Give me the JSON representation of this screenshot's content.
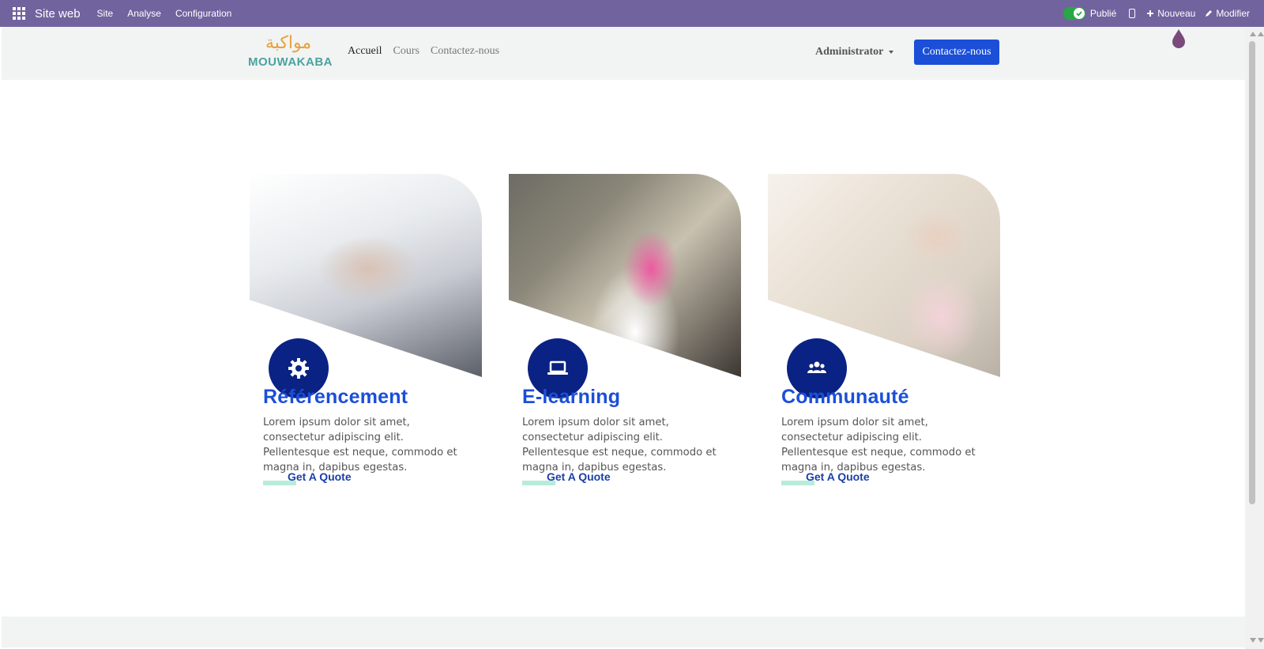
{
  "admin_bar": {
    "brand": "Site web",
    "menu": [
      "Site",
      "Analyse",
      "Configuration"
    ],
    "published_label": "Publié",
    "new_label": "Nouveau",
    "edit_label": "Modifier",
    "color": "#71639e"
  },
  "site_header": {
    "logo_arabic": "مواكبة",
    "logo_text": "MOUWAKABA",
    "nav": [
      "Accueil",
      "Cours",
      "Contactez-nous"
    ],
    "user": "Administrator",
    "cta": "Contactez-nous"
  },
  "cards": [
    {
      "icon": "gear-icon",
      "title": "Référencement",
      "text": "Lorem ipsum dolor sit amet, consectetur adipiscing elit. Pellentesque est neque, commodo et magna in, dapibus egestas.",
      "link": "Get A Quote"
    },
    {
      "icon": "laptop-icon",
      "title": "E-learning",
      "text": "Lorem ipsum dolor sit amet, consectetur adipiscing elit. Pellentesque est neque, commodo et magna in, dapibus egestas.",
      "link": "Get A Quote"
    },
    {
      "icon": "users-icon",
      "title": "Communauté",
      "text": "Lorem ipsum dolor sit amet, consectetur adipiscing elit. Pellentesque est neque, commodo et magna in, dapibus egestas.",
      "link": "Get A Quote"
    }
  ],
  "colors": {
    "accent": "#1b4fd8",
    "icon_bg": "#0a2283",
    "highlight": "#b8ecd9"
  }
}
